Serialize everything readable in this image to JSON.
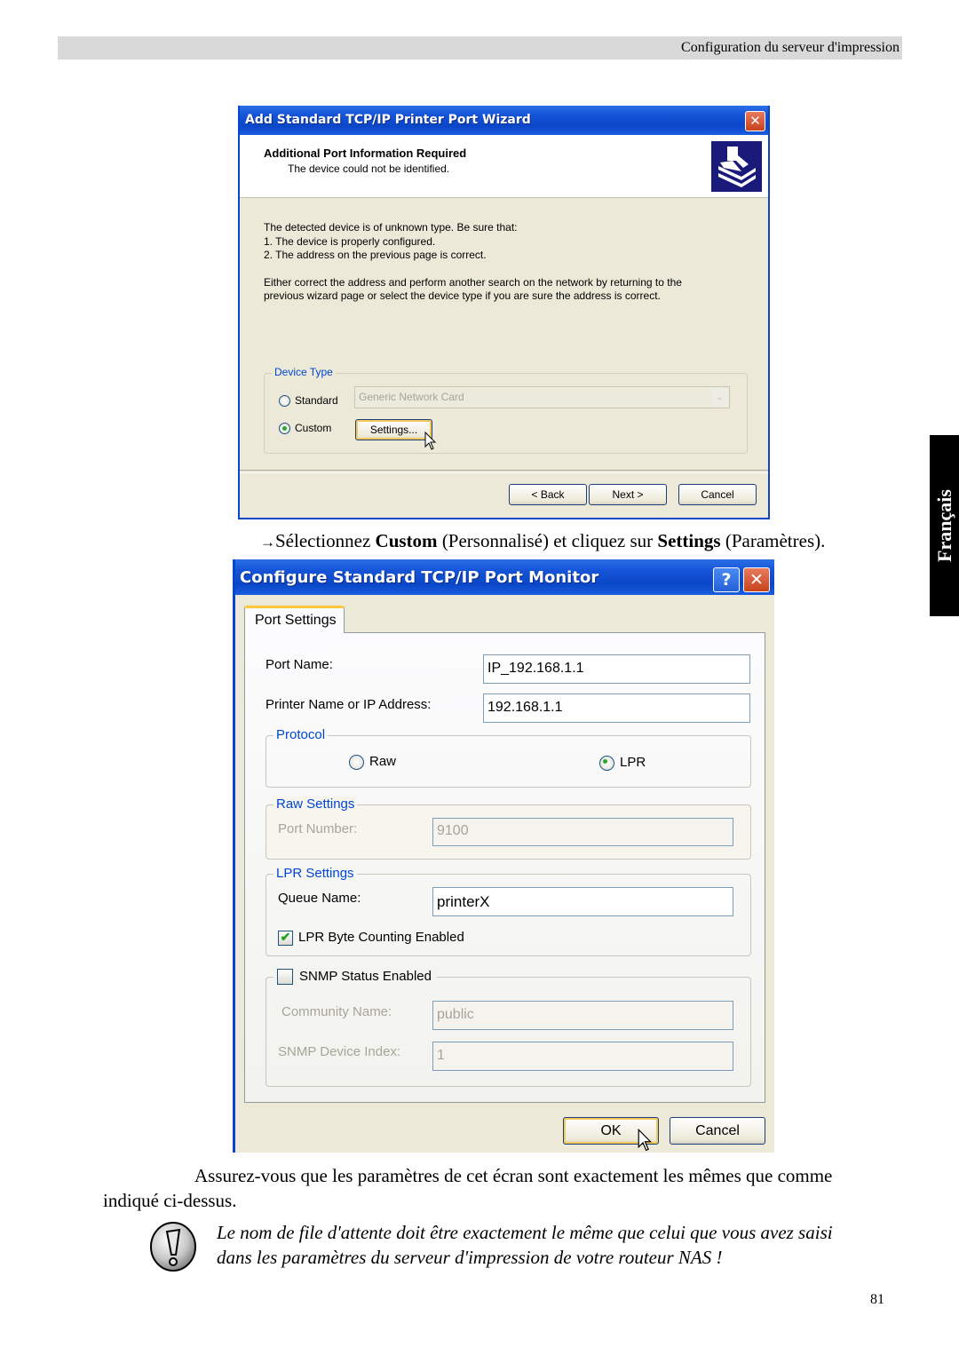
{
  "header": {
    "section_title": "Configuration du serveur d'impression"
  },
  "side_tab": {
    "language": "Français"
  },
  "wizard": {
    "title": "Add Standard TCP/IP Printer Port Wizard",
    "close_icon": "close-icon",
    "heading": "Additional Port Information Required",
    "subheading": "The device could not be identified.",
    "header_icon": "printer-icon",
    "body_lines": [
      "The detected device is of unknown type.  Be sure that:",
      "1. The device is properly configured.",
      "2.  The address on the previous page is correct."
    ],
    "body_para": [
      "Either correct the address and perform another search on the network by returning to the",
      "previous wizard page or select the device type if you are sure the address is correct."
    ],
    "device_type": {
      "legend": "Device Type",
      "standard_label": "Standard",
      "standard_checked": false,
      "standard_select_value": "Generic Network Card",
      "custom_label": "Custom",
      "custom_checked": true,
      "settings_button": "Settings..."
    },
    "buttons": {
      "back": "< Back",
      "next": "Next >",
      "cancel": "Cancel"
    }
  },
  "instruction": {
    "arrow": "→",
    "text1": "Sélectionnez ",
    "bold1": "Custom",
    "text2": " (Personnalisé) et cliquez sur ",
    "bold2": "Settings",
    "text3": " (Paramètres)."
  },
  "monitor": {
    "title": "Configure Standard TCP/IP Port Monitor",
    "help_icon": "help-icon",
    "close_icon": "close-icon",
    "tab": "Port Settings",
    "port_name_label": "Port Name:",
    "port_name_value": "IP_192.168.1.1",
    "printer_label": "Printer Name or IP Address:",
    "printer_value": "192.168.1.1",
    "protocol": {
      "legend": "Protocol",
      "raw_label": "Raw",
      "raw_checked": false,
      "lpr_label": "LPR",
      "lpr_checked": true
    },
    "raw_settings": {
      "legend": "Raw Settings",
      "port_number_label": "Port Number:",
      "port_number_value": "9100"
    },
    "lpr_settings": {
      "legend": "LPR Settings",
      "queue_label": "Queue Name:",
      "queue_value": "printerX",
      "byte_counting_label": "LPR Byte Counting Enabled",
      "byte_counting_checked": true
    },
    "snmp": {
      "enabled_label": "SNMP Status Enabled",
      "enabled_checked": false,
      "community_label": "Community Name:",
      "community_value": "public",
      "index_label": "SNMP Device Index:",
      "index_value": "1"
    },
    "buttons": {
      "ok": "OK",
      "cancel": "Cancel"
    }
  },
  "body": {
    "para_line1": "Assurez-vous que les paramètres de cet écran sont exactement les mêmes que comme",
    "para_line2": "indiqué ci-dessus.",
    "note_line1": "Le nom de file d'attente doit être exactement le même que celui que vous avez saisi",
    "note_line2": "dans les paramètres du serveur d'impression de votre routeur NAS !"
  },
  "page_number": "81"
}
